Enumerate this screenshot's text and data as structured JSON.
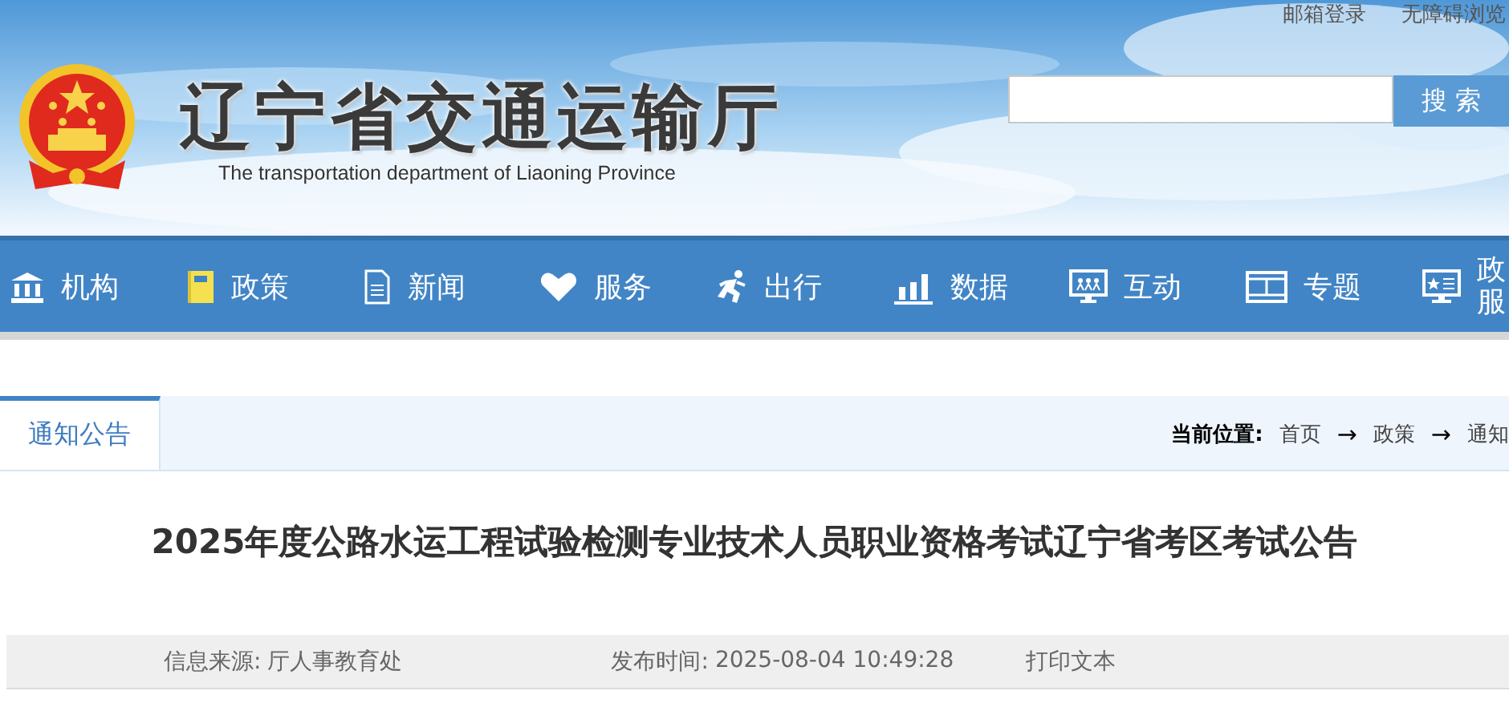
{
  "header": {
    "title": "辽宁省交通运输厅",
    "subtitle": "The transportation department of Liaoning Province",
    "top_links": [
      "邮箱登录",
      "无障碍浏览"
    ],
    "search": {
      "button": "搜 索"
    }
  },
  "nav": [
    {
      "label": "机构",
      "kind": "building"
    },
    {
      "label": "政策",
      "kind": "notebook"
    },
    {
      "label": "新闻",
      "kind": "document"
    },
    {
      "label": "服务",
      "kind": "heart"
    },
    {
      "label": "出行",
      "kind": "runner"
    },
    {
      "label": "数据",
      "kind": "bars"
    },
    {
      "label": "互动",
      "kind": "people"
    },
    {
      "label": "专题",
      "kind": "film"
    },
    {
      "label": "政服",
      "kind": "screen"
    }
  ],
  "section": {
    "tabs": [
      {
        "label": "通知公告",
        "selected": true
      }
    ],
    "breadcrumb": {
      "label": "当前位置:",
      "items": [
        "首页",
        "政策",
        "通知"
      ],
      "separator": "→"
    }
  },
  "article": {
    "title": "2025年度公路水运工程试验检测专业技术人员职业资格考试辽宁省考区考试公告",
    "meta": [
      {
        "label": "信息来源:",
        "value": "厅人事教育处"
      },
      {
        "label": "发布时间:",
        "value": "2025-08-04 10:49:28"
      }
    ],
    "print": "打印文本"
  }
}
